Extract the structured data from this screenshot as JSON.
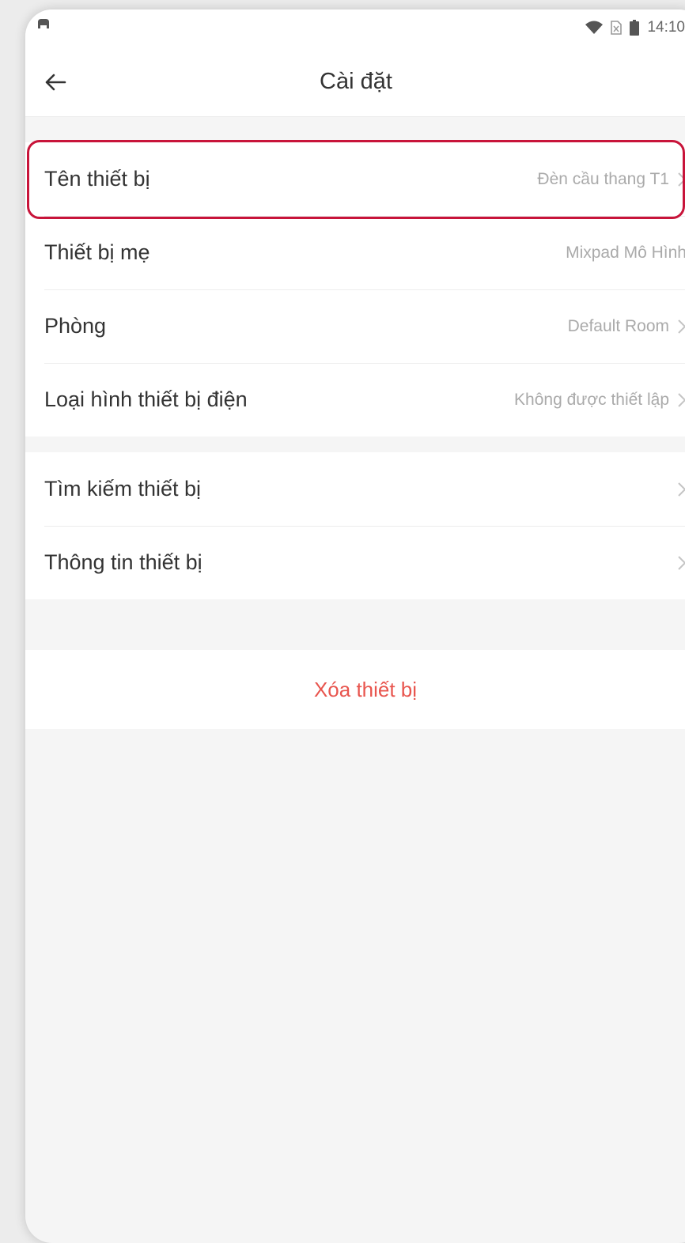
{
  "status_bar": {
    "time": "14:10",
    "left_icon": "app-notification-icon",
    "icons": [
      "wifi-icon",
      "no-sim-icon",
      "battery-icon"
    ]
  },
  "header": {
    "title": "Cài đặt",
    "back_icon": "back-arrow-icon"
  },
  "settings_group_1": [
    {
      "label": "Tên thiết bị",
      "value": "Đèn cầu thang T1",
      "has_chevron": true,
      "highlighted": true
    },
    {
      "label": "Thiết bị mẹ",
      "value": "Mixpad Mô Hình",
      "has_chevron": false
    },
    {
      "label": "Phòng",
      "value": "Default Room",
      "has_chevron": true
    },
    {
      "label": "Loại hình thiết bị điện",
      "value": "Không được thiết lập",
      "has_chevron": true
    }
  ],
  "settings_group_2": [
    {
      "label": "Tìm kiếm thiết bị",
      "value": "",
      "has_chevron": true
    },
    {
      "label": "Thông tin thiết bị",
      "value": "",
      "has_chevron": true
    }
  ],
  "delete_button": {
    "label": "Xóa thiết bị"
  },
  "colors": {
    "background": "#f5f5f5",
    "delete_text": "#e8554e",
    "highlight_border": "#c8143a"
  }
}
